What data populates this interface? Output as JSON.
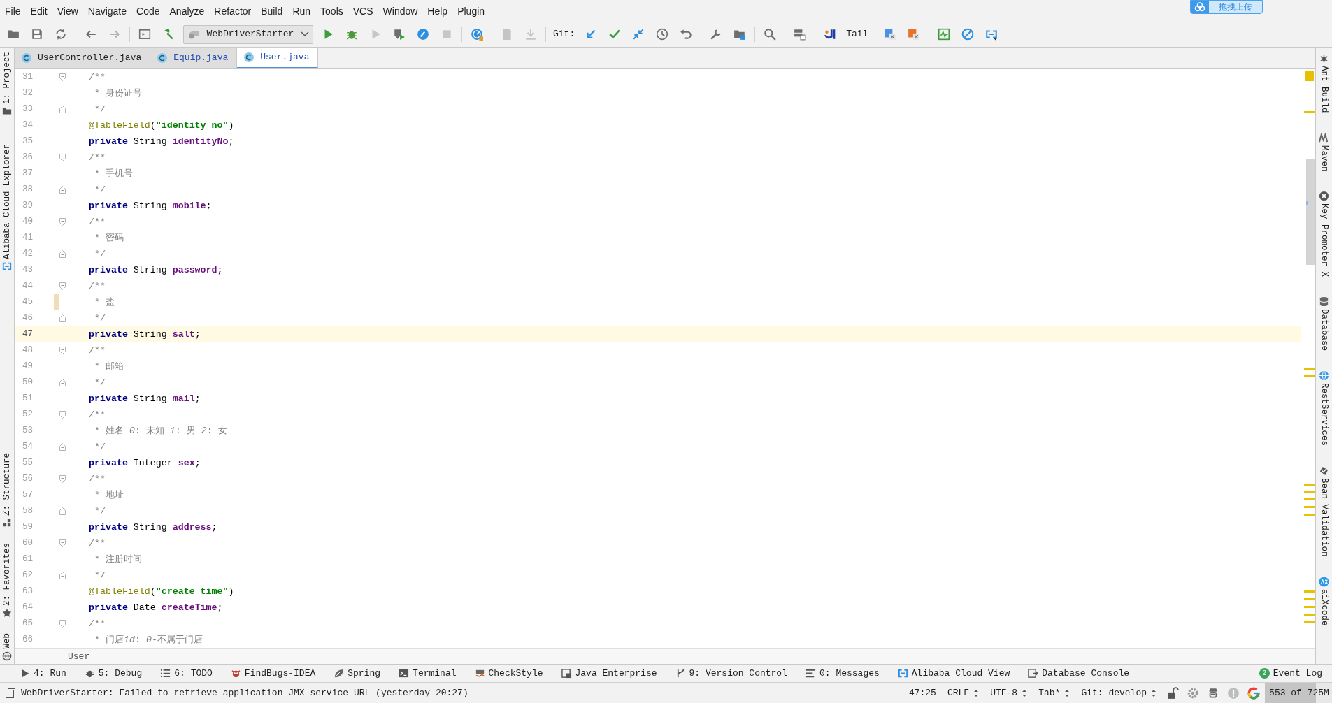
{
  "menu": [
    "File",
    "Edit",
    "View",
    "Navigate",
    "Code",
    "Analyze",
    "Refactor",
    "Build",
    "Run",
    "Tools",
    "VCS",
    "Window",
    "Help",
    "Plugin"
  ],
  "upload_button": "拖拽上传",
  "toolbar": {
    "run_configuration": "WebDriverStarter",
    "git_label": "Git:",
    "tail_label": "Tail"
  },
  "tabs": [
    {
      "label": "UserController.java",
      "selected": false,
      "modified": false
    },
    {
      "label": "Equip.java",
      "selected": false,
      "modified": true
    },
    {
      "label": "User.java",
      "selected": true,
      "modified": true
    }
  ],
  "left_tools_top": [
    {
      "label": "1: Project"
    },
    {
      "label": "Alibaba Cloud Explorer"
    }
  ],
  "left_tools_bottom": [
    {
      "label": "Z: Structure"
    },
    {
      "label": "2: Favorites"
    },
    {
      "label": "Web"
    }
  ],
  "editor": {
    "lines": [
      {
        "number": "31",
        "current": false,
        "changed": false,
        "fold_start": true,
        "fold_end": false,
        "tokens": [
          {
            "text": "/**",
            "kind": "comment"
          }
        ]
      },
      {
        "number": "32",
        "current": false,
        "changed": false,
        "fold_start": false,
        "fold_end": false,
        "tokens": [
          {
            "text": " * 身份证号",
            "kind": "comment"
          }
        ]
      },
      {
        "number": "33",
        "current": false,
        "changed": false,
        "fold_start": false,
        "fold_end": true,
        "tokens": [
          {
            "text": " */",
            "kind": "comment"
          }
        ]
      },
      {
        "number": "34",
        "current": false,
        "changed": false,
        "fold_start": false,
        "fold_end": false,
        "tokens": [
          {
            "text": "@TableField",
            "kind": "annotation"
          },
          {
            "text": "(",
            "kind": "punct"
          },
          {
            "text": "\"identity_no\"",
            "kind": "string"
          },
          {
            "text": ")",
            "kind": "punct"
          }
        ]
      },
      {
        "number": "35",
        "current": false,
        "changed": false,
        "fold_start": false,
        "fold_end": false,
        "tokens": [
          {
            "text": "private ",
            "kind": "keyword"
          },
          {
            "text": "String ",
            "kind": "type"
          },
          {
            "text": "identityNo",
            "kind": "field"
          },
          {
            "text": ";",
            "kind": "punct"
          }
        ]
      },
      {
        "number": "36",
        "current": false,
        "changed": false,
        "fold_start": true,
        "fold_end": false,
        "tokens": [
          {
            "text": "/**",
            "kind": "comment"
          }
        ]
      },
      {
        "number": "37",
        "current": false,
        "changed": false,
        "fold_start": false,
        "fold_end": false,
        "tokens": [
          {
            "text": " * 手机号",
            "kind": "comment"
          }
        ]
      },
      {
        "number": "38",
        "current": false,
        "changed": false,
        "fold_start": false,
        "fold_end": true,
        "tokens": [
          {
            "text": " */",
            "kind": "comment"
          }
        ]
      },
      {
        "number": "39",
        "current": false,
        "changed": false,
        "fold_start": false,
        "fold_end": false,
        "tokens": [
          {
            "text": "private ",
            "kind": "keyword"
          },
          {
            "text": "String ",
            "kind": "type"
          },
          {
            "text": "mobile",
            "kind": "field"
          },
          {
            "text": ";",
            "kind": "punct"
          }
        ]
      },
      {
        "number": "40",
        "current": false,
        "changed": false,
        "fold_start": true,
        "fold_end": false,
        "tokens": [
          {
            "text": "/**",
            "kind": "comment"
          }
        ]
      },
      {
        "number": "41",
        "current": false,
        "changed": false,
        "fold_start": false,
        "fold_end": false,
        "tokens": [
          {
            "text": " * 密码",
            "kind": "comment"
          }
        ]
      },
      {
        "number": "42",
        "current": false,
        "changed": false,
        "fold_start": false,
        "fold_end": true,
        "tokens": [
          {
            "text": " */",
            "kind": "comment"
          }
        ]
      },
      {
        "number": "43",
        "current": false,
        "changed": false,
        "fold_start": false,
        "fold_end": false,
        "tokens": [
          {
            "text": "private ",
            "kind": "keyword"
          },
          {
            "text": "String ",
            "kind": "type"
          },
          {
            "text": "password",
            "kind": "field"
          },
          {
            "text": ";",
            "kind": "punct"
          }
        ]
      },
      {
        "number": "44",
        "current": false,
        "changed": false,
        "fold_start": true,
        "fold_end": false,
        "tokens": [
          {
            "text": "/**",
            "kind": "comment"
          }
        ]
      },
      {
        "number": "45",
        "current": false,
        "changed": true,
        "fold_start": false,
        "fold_end": false,
        "tokens": [
          {
            "text": " * 盐",
            "kind": "comment"
          }
        ]
      },
      {
        "number": "46",
        "current": false,
        "changed": false,
        "fold_start": false,
        "fold_end": true,
        "tokens": [
          {
            "text": " */",
            "kind": "comment"
          }
        ]
      },
      {
        "number": "47",
        "current": true,
        "changed": false,
        "fold_start": false,
        "fold_end": false,
        "tokens": [
          {
            "text": "private ",
            "kind": "keyword"
          },
          {
            "text": "String ",
            "kind": "type"
          },
          {
            "text": "salt",
            "kind": "field"
          },
          {
            "text": ";",
            "kind": "punct"
          }
        ]
      },
      {
        "number": "48",
        "current": false,
        "changed": false,
        "fold_start": true,
        "fold_end": false,
        "tokens": [
          {
            "text": "/**",
            "kind": "comment"
          }
        ]
      },
      {
        "number": "49",
        "current": false,
        "changed": false,
        "fold_start": false,
        "fold_end": false,
        "tokens": [
          {
            "text": " * 邮箱",
            "kind": "comment"
          }
        ]
      },
      {
        "number": "50",
        "current": false,
        "changed": false,
        "fold_start": false,
        "fold_end": true,
        "tokens": [
          {
            "text": " */",
            "kind": "comment"
          }
        ]
      },
      {
        "number": "51",
        "current": false,
        "changed": false,
        "fold_start": false,
        "fold_end": false,
        "tokens": [
          {
            "text": "private ",
            "kind": "keyword"
          },
          {
            "text": "String ",
            "kind": "type"
          },
          {
            "text": "mail",
            "kind": "field"
          },
          {
            "text": ";",
            "kind": "punct"
          }
        ]
      },
      {
        "number": "52",
        "current": false,
        "changed": false,
        "fold_start": true,
        "fold_end": false,
        "tokens": [
          {
            "text": "/**",
            "kind": "comment"
          }
        ]
      },
      {
        "number": "53",
        "current": false,
        "changed": false,
        "fold_start": false,
        "fold_end": false,
        "tokens": [
          {
            "text": " * 姓名 ",
            "kind": "comment"
          },
          {
            "text": "0",
            "kind": "comment_tag"
          },
          {
            "text": ": 未知 ",
            "kind": "comment"
          },
          {
            "text": "1",
            "kind": "comment_tag"
          },
          {
            "text": ": 男 ",
            "kind": "comment"
          },
          {
            "text": "2",
            "kind": "comment_tag"
          },
          {
            "text": ": 女",
            "kind": "comment"
          }
        ]
      },
      {
        "number": "54",
        "current": false,
        "changed": false,
        "fold_start": false,
        "fold_end": true,
        "tokens": [
          {
            "text": " */",
            "kind": "comment"
          }
        ]
      },
      {
        "number": "55",
        "current": false,
        "changed": false,
        "fold_start": false,
        "fold_end": false,
        "tokens": [
          {
            "text": "private ",
            "kind": "keyword"
          },
          {
            "text": "Integer ",
            "kind": "type"
          },
          {
            "text": "sex",
            "kind": "field"
          },
          {
            "text": ";",
            "kind": "punct"
          }
        ]
      },
      {
        "number": "56",
        "current": false,
        "changed": false,
        "fold_start": true,
        "fold_end": false,
        "tokens": [
          {
            "text": "/**",
            "kind": "comment"
          }
        ]
      },
      {
        "number": "57",
        "current": false,
        "changed": false,
        "fold_start": false,
        "fold_end": false,
        "tokens": [
          {
            "text": " * 地址",
            "kind": "comment"
          }
        ]
      },
      {
        "number": "58",
        "current": false,
        "changed": false,
        "fold_start": false,
        "fold_end": true,
        "tokens": [
          {
            "text": " */",
            "kind": "comment"
          }
        ]
      },
      {
        "number": "59",
        "current": false,
        "changed": false,
        "fold_start": false,
        "fold_end": false,
        "tokens": [
          {
            "text": "private ",
            "kind": "keyword"
          },
          {
            "text": "String ",
            "kind": "type"
          },
          {
            "text": "address",
            "kind": "field"
          },
          {
            "text": ";",
            "kind": "punct"
          }
        ]
      },
      {
        "number": "60",
        "current": false,
        "changed": false,
        "fold_start": true,
        "fold_end": false,
        "tokens": [
          {
            "text": "/**",
            "kind": "comment"
          }
        ]
      },
      {
        "number": "61",
        "current": false,
        "changed": false,
        "fold_start": false,
        "fold_end": false,
        "tokens": [
          {
            "text": " * 注册时间",
            "kind": "comment"
          }
        ]
      },
      {
        "number": "62",
        "current": false,
        "changed": false,
        "fold_start": false,
        "fold_end": true,
        "tokens": [
          {
            "text": " */",
            "kind": "comment"
          }
        ]
      },
      {
        "number": "63",
        "current": false,
        "changed": false,
        "fold_start": false,
        "fold_end": false,
        "tokens": [
          {
            "text": "@TableField",
            "kind": "annotation"
          },
          {
            "text": "(",
            "kind": "punct"
          },
          {
            "text": "\"create_time\"",
            "kind": "string"
          },
          {
            "text": ")",
            "kind": "punct"
          }
        ]
      },
      {
        "number": "64",
        "current": false,
        "changed": false,
        "fold_start": false,
        "fold_end": false,
        "tokens": [
          {
            "text": "private ",
            "kind": "keyword"
          },
          {
            "text": "Date ",
            "kind": "type"
          },
          {
            "text": "createTime",
            "kind": "field"
          },
          {
            "text": ";",
            "kind": "punct"
          }
        ]
      },
      {
        "number": "65",
        "current": false,
        "changed": false,
        "fold_start": true,
        "fold_end": false,
        "tokens": [
          {
            "text": "/**",
            "kind": "comment"
          }
        ]
      },
      {
        "number": "66",
        "current": false,
        "changed": false,
        "fold_start": false,
        "fold_end": false,
        "tokens": [
          {
            "text": " * 门店",
            "kind": "comment"
          },
          {
            "text": "id",
            "kind": "comment_tag"
          },
          {
            "text": ": ",
            "kind": "comment"
          },
          {
            "text": "0",
            "kind": "comment_tag"
          },
          {
            "text": "-不属于门店",
            "kind": "comment"
          }
        ]
      }
    ]
  },
  "breadcrumb": "User",
  "right_tools": [
    {
      "label": "Ant Build"
    },
    {
      "label": "Maven"
    },
    {
      "label": "Key Promoter X"
    },
    {
      "label": "Database"
    },
    {
      "label": "RestServices"
    },
    {
      "label": "Bean Validation"
    },
    {
      "label": "aiXcode"
    }
  ],
  "bottom_tools": [
    {
      "label": "4: Run"
    },
    {
      "label": "5: Debug"
    },
    {
      "label": "6: TODO"
    },
    {
      "label": "FindBugs-IDEA"
    },
    {
      "label": "Spring"
    },
    {
      "label": "Terminal"
    },
    {
      "label": "CheckStyle"
    },
    {
      "label": "Java Enterprise"
    },
    {
      "label": "9: Version Control"
    },
    {
      "label": "0: Messages"
    },
    {
      "label": "Alibaba Cloud View"
    },
    {
      "label": "Database Console"
    },
    {
      "label": "Event Log",
      "badge": "2"
    }
  ],
  "status": {
    "message": "WebDriverStarter: Failed to retrieve application JMX service URL (yesterday 20:27)",
    "position": "47:25",
    "line_separator": "CRLF",
    "encoding": "UTF-8",
    "indent": "Tab*",
    "branch": "Git: develop",
    "memory": {
      "text": "553 of 725M",
      "level": 0.76
    }
  }
}
